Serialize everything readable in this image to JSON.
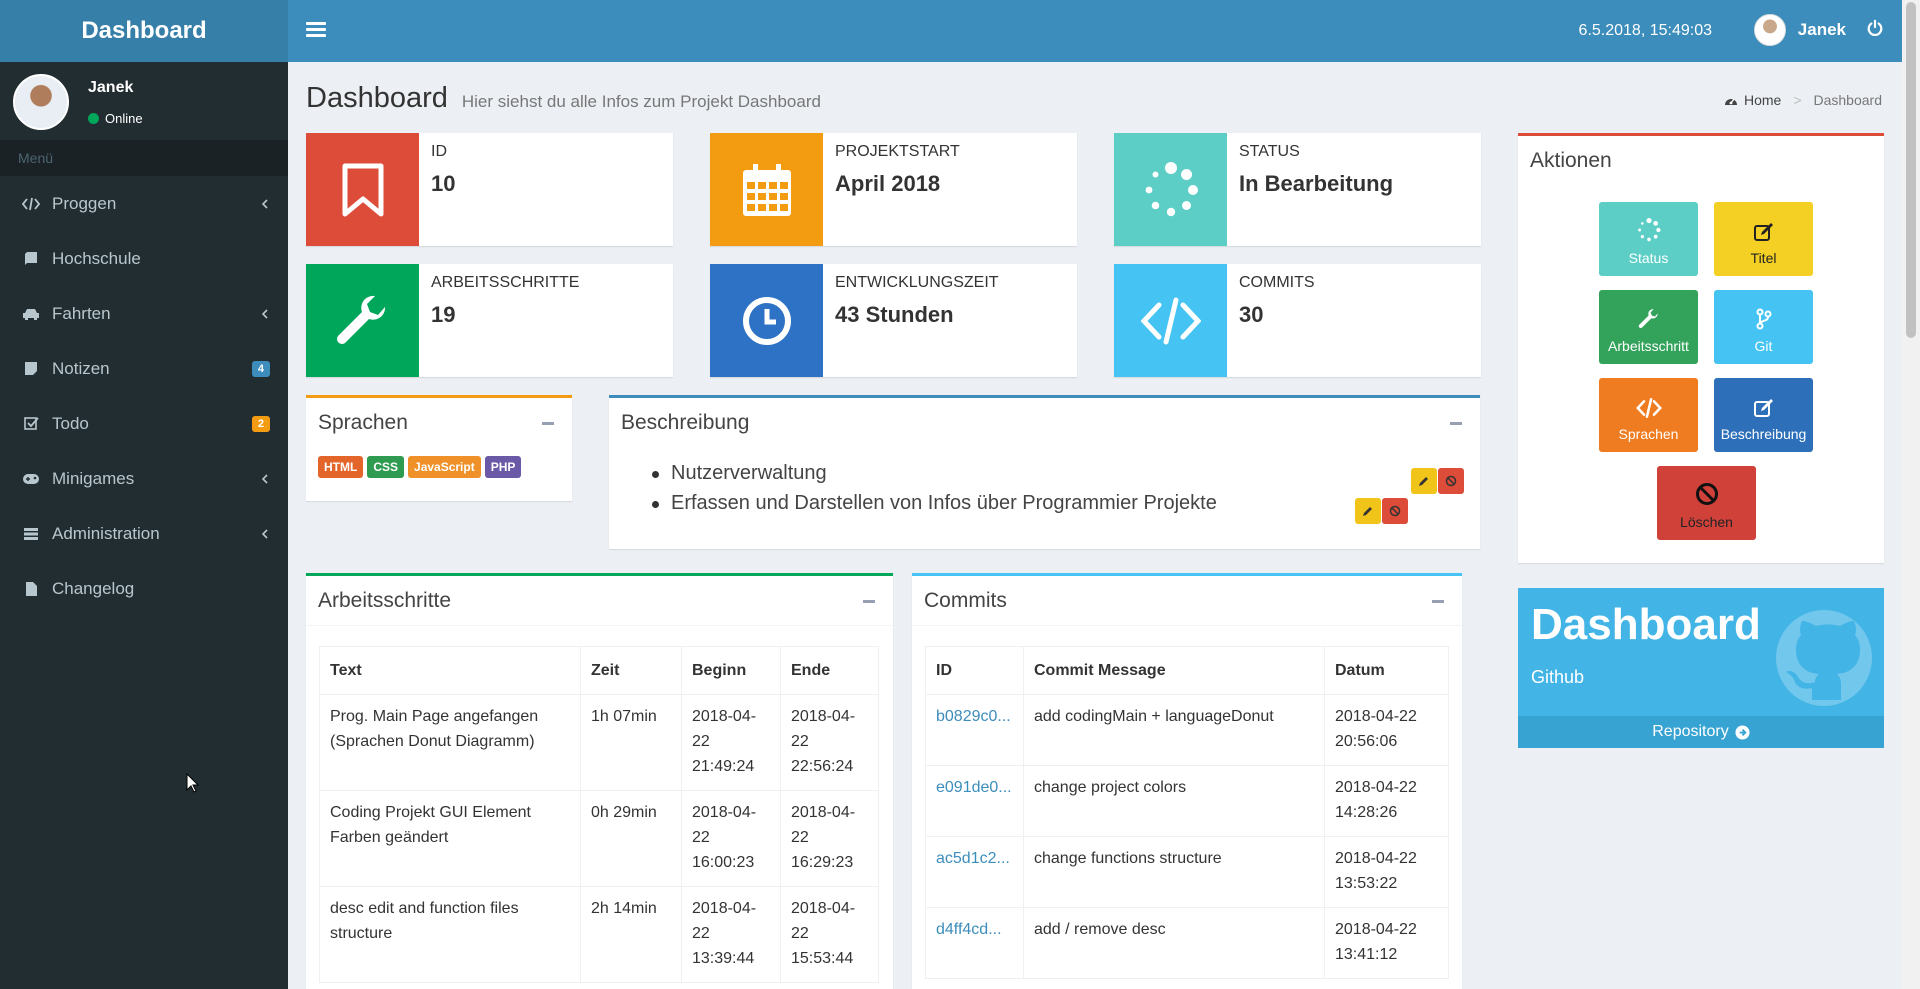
{
  "app": {
    "logo": "Dashboard"
  },
  "header": {
    "datetime": "6.5.2018, 15:49:03",
    "user": "Janek"
  },
  "sidebar": {
    "user": {
      "name": "Janek",
      "status": "Online"
    },
    "menu_header": "Menü",
    "items": [
      {
        "label": "Proggen"
      },
      {
        "label": "Hochschule"
      },
      {
        "label": "Fahrten"
      },
      {
        "label": "Notizen",
        "badge": "4"
      },
      {
        "label": "Todo",
        "badge": "2"
      },
      {
        "label": "Minigames"
      },
      {
        "label": "Administration"
      },
      {
        "label": "Changelog"
      }
    ]
  },
  "page": {
    "title": "Dashboard",
    "subtitle": "Hier siehst du alle Infos zum Projekt Dashboard"
  },
  "breadcrumb": {
    "home": "Home",
    "current": "Dashboard"
  },
  "info_boxes": [
    {
      "label": "ID",
      "value": "10",
      "color": "#dd4b39"
    },
    {
      "label": "Projektstart",
      "value": "April 2018",
      "color": "#f39c12"
    },
    {
      "label": "Status",
      "value": "In Bearbeitung",
      "color": "#5ccec6"
    },
    {
      "label": "Arbeitsschritte",
      "value": "19",
      "color": "#00a65a"
    },
    {
      "label": "Entwicklungszeit",
      "value": "43 Stunden",
      "color": "#2d72c4"
    },
    {
      "label": "Commits",
      "value": "30",
      "color": "#45c4f4"
    }
  ],
  "sprachen": {
    "title": "Sprachen",
    "tags": [
      "HTML",
      "CSS",
      "JavaScript",
      "PHP"
    ]
  },
  "beschreibung": {
    "title": "Beschreibung",
    "items": [
      "Nutzerverwaltung",
      "Erfassen und Darstellen von Infos über Programmier Projekte"
    ]
  },
  "arbeitsschritte": {
    "title": "Arbeitsschritte",
    "headers": [
      "Text",
      "Zeit",
      "Beginn",
      "Ende"
    ],
    "rows": [
      {
        "text": "Prog. Main Page angefangen (Sprachen Donut Diagramm)",
        "zeit": "1h 07min",
        "beginn": "2018-04-22 21:49:24",
        "ende": "2018-04-22 22:56:24"
      },
      {
        "text": "Coding Projekt GUI Element Farben geändert",
        "zeit": "0h 29min",
        "beginn": "2018-04-22 16:00:23",
        "ende": "2018-04-22 16:29:23"
      },
      {
        "text": "desc edit and function files structure",
        "zeit": "2h 14min",
        "beginn": "2018-04-22 13:39:44",
        "ende": "2018-04-22 15:53:44"
      }
    ]
  },
  "commits": {
    "title": "Commits",
    "headers": [
      "ID",
      "Commit Message",
      "Datum"
    ],
    "rows": [
      {
        "id": "b0829c0...",
        "msg": "add codingMain + languageDonut",
        "datum": "2018-04-22 20:56:06"
      },
      {
        "id": "e091de0...",
        "msg": "change project colors",
        "datum": "2018-04-22 14:28:26"
      },
      {
        "id": "ac5d1c2...",
        "msg": "change functions structure",
        "datum": "2018-04-22 13:53:22"
      },
      {
        "id": "d4ff4cd...",
        "msg": "add / remove desc",
        "datum": "2018-04-22 13:41:12"
      }
    ]
  },
  "aktionen": {
    "title": "Aktionen",
    "buttons": [
      {
        "label": "Status",
        "color": "#5ccec6"
      },
      {
        "label": "Titel",
        "color": "#f5d024"
      },
      {
        "label": "Arbeitsschritt",
        "color": "#33a35c"
      },
      {
        "label": "Git",
        "color": "#45c4f4"
      },
      {
        "label": "Sprachen",
        "color": "#f07c22"
      },
      {
        "label": "Beschreibung",
        "color": "#2d6fb9"
      },
      {
        "label": "Löschen",
        "color": "#d0413a"
      }
    ]
  },
  "github": {
    "title": "Dashboard",
    "subtitle": "Github",
    "link": "Repository"
  }
}
